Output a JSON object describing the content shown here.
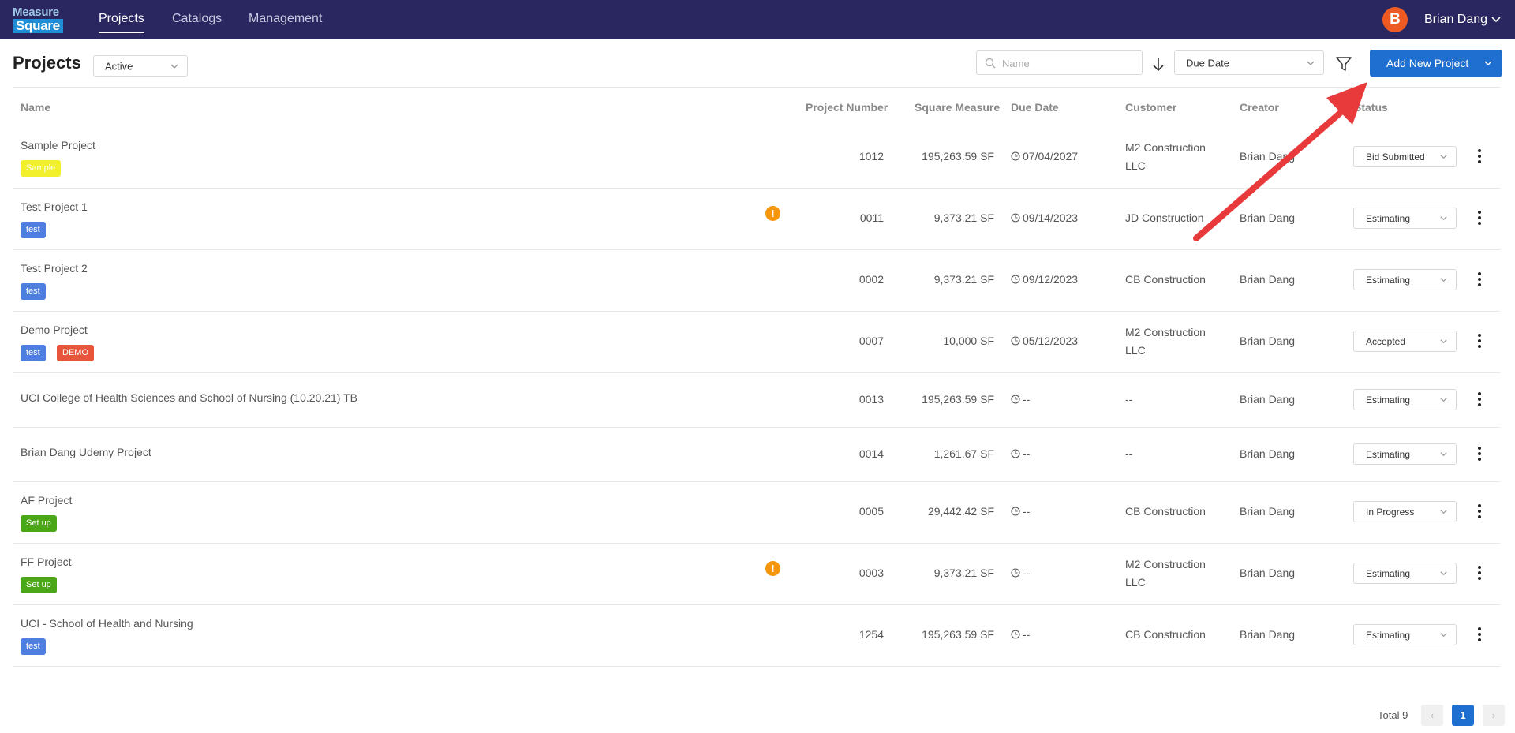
{
  "brand": {
    "logo_line1": "Measure",
    "logo_line2": "Square"
  },
  "nav": {
    "items": [
      "Projects",
      "Catalogs",
      "Management"
    ],
    "active": "Projects"
  },
  "user": {
    "initial": "B",
    "name": "Brian Dang"
  },
  "page": {
    "title": "Projects"
  },
  "status_filter": {
    "value": "Active"
  },
  "search": {
    "placeholder": "Name"
  },
  "sort": {
    "value": "Due Date"
  },
  "add_button": {
    "label": "Add New Project"
  },
  "table": {
    "headers": [
      "Name",
      "Project Number",
      "Square Measure",
      "Due Date",
      "Customer",
      "Creator",
      "Status"
    ],
    "rows": [
      {
        "name": "Sample Project",
        "tags": [
          {
            "text": "Sample",
            "kind": "sample"
          }
        ],
        "warning": false,
        "number": "1012",
        "measure": "195,263.59 SF",
        "due": "07/04/2027",
        "customer": [
          "M2 Construction",
          "LLC"
        ],
        "creator": "Brian Dang",
        "status": "Bid Submitted"
      },
      {
        "name": "Test Project 1",
        "tags": [
          {
            "text": "test",
            "kind": "test"
          }
        ],
        "warning": true,
        "number": "0011",
        "measure": "9,373.21 SF",
        "due": "09/14/2023",
        "customer": [
          "JD Construction"
        ],
        "creator": "Brian Dang",
        "status": "Estimating"
      },
      {
        "name": "Test Project 2",
        "tags": [
          {
            "text": "test",
            "kind": "test"
          }
        ],
        "warning": false,
        "number": "0002",
        "measure": "9,373.21 SF",
        "due": "09/12/2023",
        "customer": [
          "CB Construction"
        ],
        "creator": "Brian Dang",
        "status": "Estimating"
      },
      {
        "name": "Demo Project",
        "tags": [
          {
            "text": "test",
            "kind": "test"
          },
          {
            "text": "DEMO",
            "kind": "demo"
          }
        ],
        "warning": false,
        "number": "0007",
        "measure": "10,000 SF",
        "due": "05/12/2023",
        "customer": [
          "M2 Construction",
          "LLC"
        ],
        "creator": "Brian Dang",
        "status": "Accepted"
      },
      {
        "name": "UCI College of Health Sciences and School of Nursing (10.20.21) TB",
        "tags": [],
        "warning": false,
        "number": "0013",
        "measure": "195,263.59 SF",
        "due": "--",
        "customer": [
          "--"
        ],
        "creator": "Brian Dang",
        "status": "Estimating"
      },
      {
        "name": "Brian Dang Udemy Project",
        "tags": [],
        "warning": false,
        "number": "0014",
        "measure": "1,261.67 SF",
        "due": "--",
        "customer": [
          "--"
        ],
        "creator": "Brian Dang",
        "status": "Estimating"
      },
      {
        "name": "AF Project",
        "tags": [
          {
            "text": "Set up",
            "kind": "setup"
          }
        ],
        "warning": false,
        "number": "0005",
        "measure": "29,442.42 SF",
        "due": "--",
        "customer": [
          "CB Construction"
        ],
        "creator": "Brian Dang",
        "status": "In Progress"
      },
      {
        "name": "FF Project",
        "tags": [
          {
            "text": "Set up",
            "kind": "setup"
          }
        ],
        "warning": true,
        "number": "0003",
        "measure": "9,373.21 SF",
        "due": "--",
        "customer": [
          "M2 Construction",
          "LLC"
        ],
        "creator": "Brian Dang",
        "status": "Estimating"
      },
      {
        "name": "UCI - School of Health and Nursing",
        "tags": [
          {
            "text": "test",
            "kind": "test"
          }
        ],
        "warning": false,
        "number": "1254",
        "measure": "195,263.59 SF",
        "due": "--",
        "customer": [
          "CB Construction"
        ],
        "creator": "Brian Dang",
        "status": "Estimating"
      }
    ]
  },
  "pagination": {
    "total_label": "Total 9",
    "current_page": "1",
    "prev": "‹",
    "next": "›"
  },
  "colors": {
    "nav_bg": "#2a2660",
    "primary": "#1e6fd0",
    "avatar": "#ee5a24",
    "warning": "#f5960d",
    "annotation_arrow": "#e8393b"
  }
}
